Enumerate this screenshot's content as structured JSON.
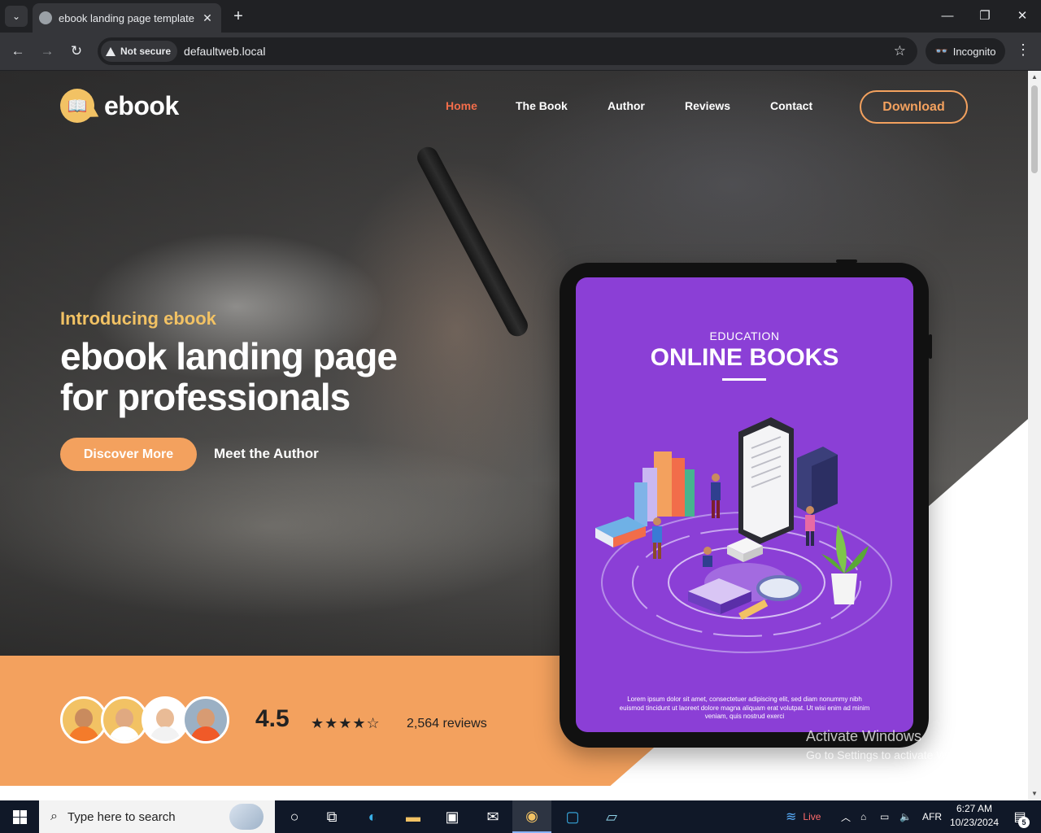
{
  "browser": {
    "tab_title": "ebook landing page template",
    "tab_close": "✕",
    "new_tab": "+",
    "not_secure_label": "Not secure",
    "url": "defaultweb.local",
    "incognito_label": "Incognito"
  },
  "site": {
    "logo_text": "ebook",
    "nav": [
      {
        "label": "Home",
        "active": true
      },
      {
        "label": "The Book",
        "active": false
      },
      {
        "label": "Author",
        "active": false
      },
      {
        "label": "Reviews",
        "active": false
      },
      {
        "label": "Contact",
        "active": false
      }
    ],
    "download_label": "Download",
    "hero": {
      "intro": "Introducing ebook",
      "headline_line1": "ebook landing page",
      "headline_line2": "for professionals",
      "primary_cta": "Discover More",
      "secondary_cta": "Meet the Author"
    },
    "reviews": {
      "rating": "4.5",
      "stars": "★★★★☆",
      "stars_value": 4.5,
      "count_label": "2,564 reviews"
    },
    "book_cover": {
      "kicker": "EDUCATION",
      "title": "ONLINE BOOKS",
      "lorem": "Lorem ipsum dolor sit amet, consectetuer adipiscing elit, sed diam nonummy nibh euismod tincidunt ut laoreet dolore magna aliquam erat volutpat. Ut wisi enim ad minim veniam, quis nostrud exerci"
    },
    "colors": {
      "accent": "#f3a15e",
      "active_nav": "#f26d4a",
      "intro_yellow": "#f2c264",
      "cover_purple": "#8b3fd6"
    }
  },
  "os_overlay": {
    "activate_title": "Activate Windows",
    "activate_sub": "Go to Settings to activate Windows."
  },
  "taskbar": {
    "search_placeholder": "Type here to search",
    "weather_label": "Live",
    "language": "AFR",
    "time": "6:27 AM",
    "date": "10/23/2024",
    "notification_count": "5"
  }
}
